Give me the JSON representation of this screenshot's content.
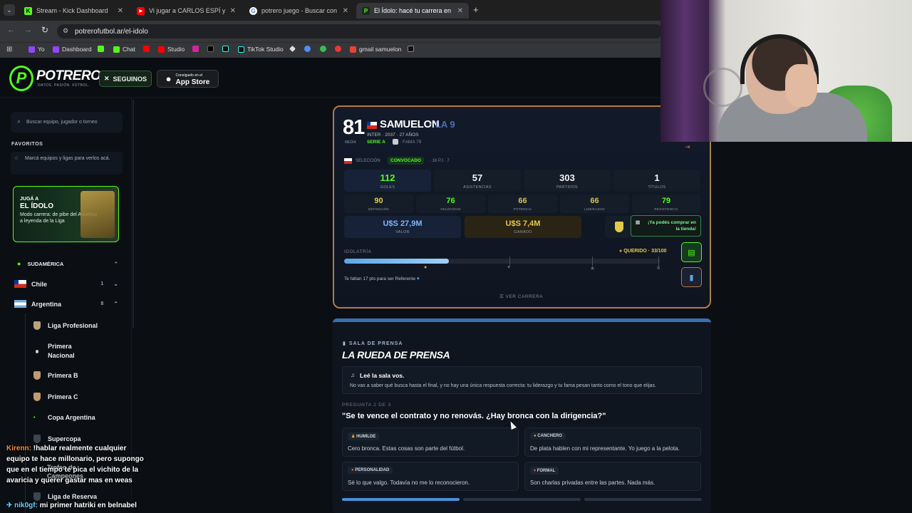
{
  "browser": {
    "tabs": [
      {
        "title": "Stream - Kick Dashboard",
        "color": "#53fc18"
      },
      {
        "title": "Vi jugar a CARLOS ESPÍ y descu",
        "color": "#ff0000"
      },
      {
        "title": "potrero juego - Buscar con Goo",
        "color": "#4285f4"
      },
      {
        "title": "El Ídolo: hacé tu carrera en la Li",
        "color": "#53fc18"
      }
    ],
    "url": "potrerofutbol.ar/el-idolo",
    "bookmarks": [
      "Yo",
      "Dashboard",
      "Chat",
      "Studio",
      "TikTok Studio",
      "gmail samuelon"
    ]
  },
  "site": {
    "logo": "POTRERO",
    "logo_tagline": "DATOS. PASIÓN. FÚTBOL.",
    "follow_label": "SEGUINOS",
    "appstore_small": "Consíguelo en el",
    "appstore_big": "App Store"
  },
  "sidebar": {
    "search_placeholder": "Buscar equipo, jugador o torneo",
    "favorites_title": "FAVORITOS",
    "favorites_hint": "Marcá equipos y ligas para verlos acá.",
    "promo": {
      "kicker": "JUGÁ A",
      "title": "EL ÍDOLO",
      "text": "Modo carrera: de pibe del Ascenso a leyenda de la Liga"
    },
    "region": "SUDAMÉRICA",
    "countries": [
      {
        "name": "Chile",
        "count": "1"
      },
      {
        "name": "Argentina",
        "count": "8"
      }
    ],
    "leagues": [
      "Liga Profesional",
      "Primera Nacional",
      "Primera B",
      "Primera C",
      "Copa Argentina",
      "Supercopa",
      "Trofeo de Campeones",
      "Liga de Reserva"
    ]
  },
  "player": {
    "rating": "81",
    "rating_label": "MEDIA",
    "name": "SAMUELON",
    "role": "· LA 9",
    "club_line": "INTER · 2037 · 27 AÑOS",
    "league": "SERIE A",
    "fame": "· FAMA 79",
    "selection_label": "SELECCIÓN",
    "selection_status": "CONVOCADO",
    "selection_stats": "· 16 PJ · 7",
    "stats": [
      {
        "value": "112",
        "label": "GOLES"
      },
      {
        "value": "57",
        "label": "ASISTENCIAS"
      },
      {
        "value": "303",
        "label": "PARTIDOS"
      },
      {
        "value": "1",
        "label": "TÍTULOS"
      }
    ],
    "attributes": [
      {
        "value": "90",
        "label": "DEFINICIÓN"
      },
      {
        "value": "76",
        "label": "VELOCIDAD"
      },
      {
        "value": "66",
        "label": "POTENCIA"
      },
      {
        "value": "66",
        "label": "LIDERAZGO"
      },
      {
        "value": "79",
        "label": "RESISTENCIA"
      }
    ],
    "money": [
      {
        "value": "U$S 27,9M",
        "label": "VALOR"
      },
      {
        "value": "U$S 7,4M",
        "label": "GANADO"
      }
    ],
    "store_tip": "¡Ya podés comprar en la tienda!",
    "idolatry_label": "IDOLATRÍA",
    "idolatry_status": "QUERIDO · 33/100",
    "idolatry_value": 33,
    "idolatry_hint": "Te faltan 17 pts para ser Referente",
    "career_link": "VER CARRERA"
  },
  "press": {
    "kicker": "SALA DE PRENSA",
    "title": "LA RUEDA DE PRENSA",
    "info_title": "Leé la sala vos.",
    "info_text": "No vas a saber qué busca hasta el final, y no hay una única respuesta correcta: tu liderazgo y tu fama pesan tanto como el tono que elijas.",
    "question_counter": "PREGUNTA 2 DE 3",
    "question": "\"Se te vence el contrato y no renovás. ¿Hay bronca con la dirigencia?\"",
    "options": [
      {
        "tag": "HUMILDE",
        "text": "Cero bronca. Estas cosas son parte del fútbol."
      },
      {
        "tag": "CANCHERO",
        "text": "De plata hablen con mi representante. Yo juego a la pelota."
      },
      {
        "tag": "PERSONALIDAD",
        "text": "Sé lo que valgo. Todavía no me lo reconocieron."
      },
      {
        "tag": "FORMAL",
        "text": "Son charlas privadas entre las partes. Nada más."
      }
    ]
  },
  "chat": [
    {
      "user": "Kirenn:",
      "user_color": "#ff8a2a",
      "text": "!hablar realmente cualquier equipo te hace millonario, pero supongo que en el tiempo te pica el vichito de la avaricia y querer gastar mas en weas"
    },
    {
      "user": "nik0gf:",
      "user_color": "#5fd6ff",
      "text": "mi primer hatriki en belnabel"
    }
  ]
}
